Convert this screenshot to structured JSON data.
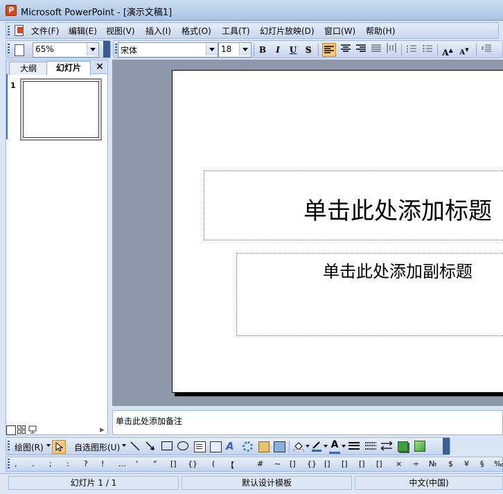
{
  "window": {
    "title": "Microsoft PowerPoint - [演示文稿1]"
  },
  "menu": [
    "文件(F)",
    "编辑(E)",
    "视图(V)",
    "插入(I)",
    "格式(O)",
    "工具(T)",
    "幻灯片放映(D)",
    "窗口(W)",
    "帮助(H)"
  ],
  "toolbar": {
    "zoom": "65%",
    "font": "宋体",
    "font_size": "18",
    "bold": "B",
    "italic": "I",
    "underline": "U",
    "shadow": "S"
  },
  "left_pane": {
    "tabs": [
      "大纲",
      "幻灯片"
    ],
    "active_tab": "幻灯片",
    "close": "×",
    "slide_number": "1"
  },
  "slide": {
    "title_placeholder": "单击此处添加标题",
    "subtitle_placeholder": "单击此处添加副标题"
  },
  "notes": {
    "placeholder": "单击此处添加备注"
  },
  "drawing": {
    "draw_label": "绘图(R)",
    "autoshapes_label": "自选图形(U)"
  },
  "punctuation": [
    ",",
    ".",
    ";",
    ":",
    "?",
    "!",
    "…",
    "‘",
    "“",
    "[]",
    "{}",
    "(",
    "【",
    "#",
    "~",
    "[]",
    "{}",
    "[]",
    "[]",
    "[]",
    "[]",
    "×",
    "÷",
    "№",
    "$",
    "¥",
    "§",
    "‰"
  ],
  "status": {
    "slide": "幻灯片 1 / 1",
    "template": "默认设计模板",
    "language": "中文(中国)"
  }
}
